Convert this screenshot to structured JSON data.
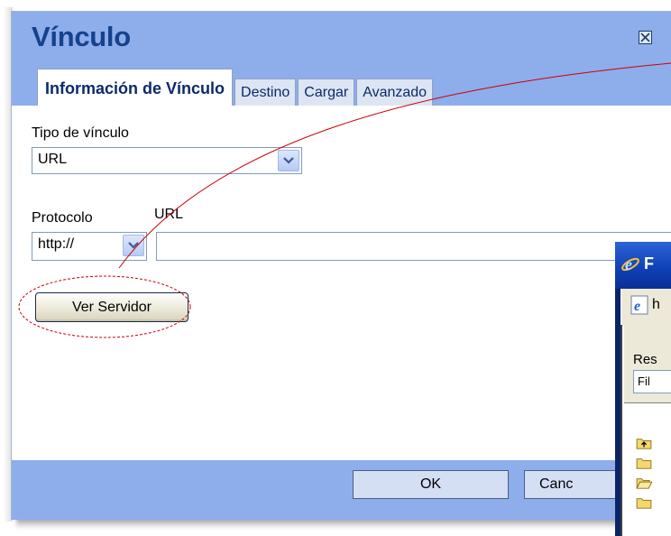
{
  "dialog": {
    "title": "Vínculo",
    "close_icon": "close-icon",
    "tabs": [
      {
        "label": "Información de Vínculo",
        "active": true
      },
      {
        "label": "Destino",
        "active": false
      },
      {
        "label": "Cargar",
        "active": false
      },
      {
        "label": "Avanzado",
        "active": false
      }
    ],
    "link_type": {
      "label": "Tipo de vínculo",
      "value": "URL"
    },
    "protocol": {
      "label": "Protocolo",
      "value": "http://"
    },
    "url": {
      "label": "URL",
      "value": ""
    },
    "browse_button": "Ver Servidor",
    "ok_button": "OK",
    "cancel_button": "Canc"
  },
  "browser_window": {
    "title": "F",
    "address_text": "h",
    "resource_label": "Res",
    "resource_select": "Fil",
    "folder_icons": [
      "folder-up-icon",
      "folder-icon",
      "folder-open-icon",
      "folder-icon"
    ]
  },
  "colors": {
    "header_blue": "#8eadeb",
    "title_text": "#15428b",
    "annotation_red": "#cc0000"
  }
}
